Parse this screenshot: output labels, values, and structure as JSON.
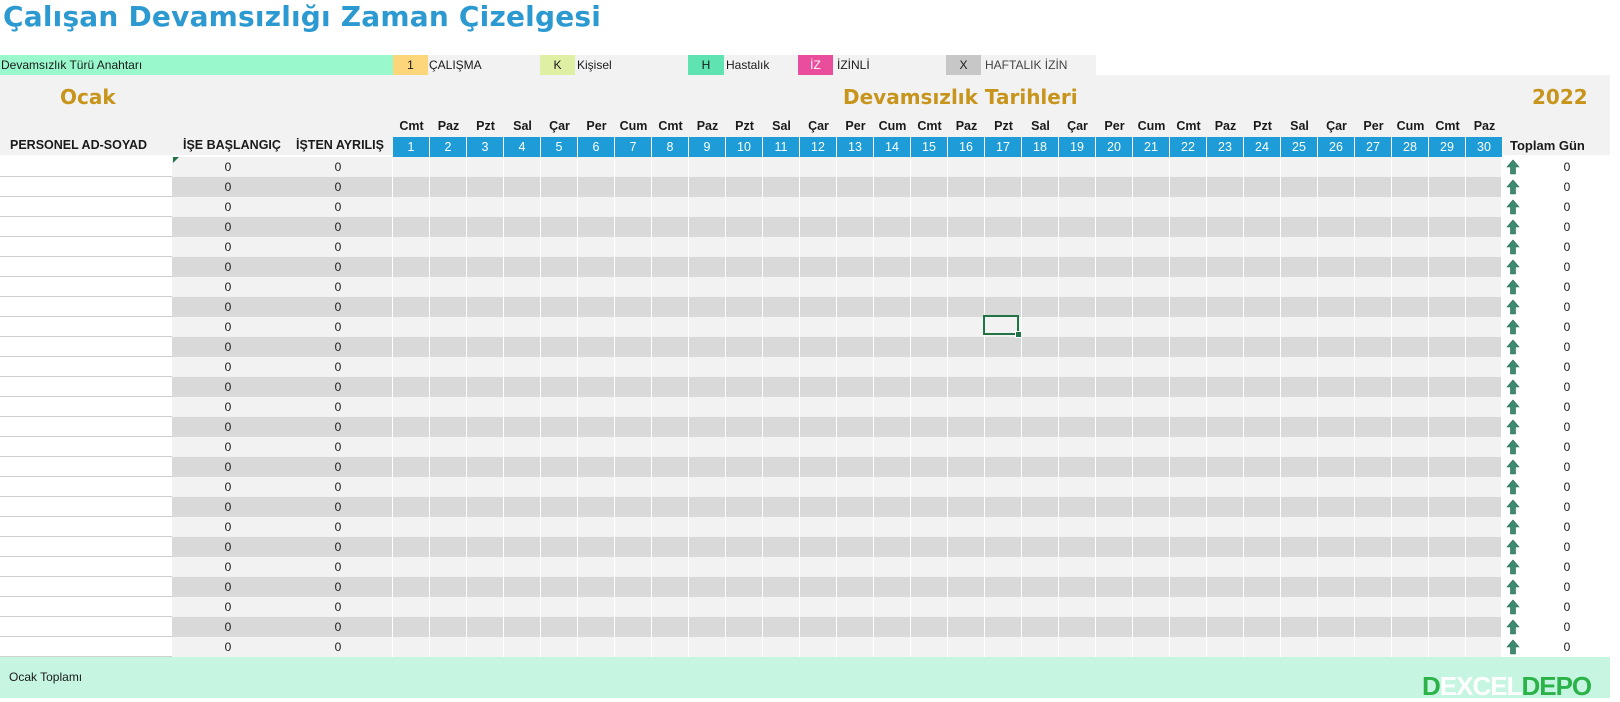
{
  "title": "Çalışan Devamsızlığı Zaman Çizelgesi",
  "legend": {
    "key_label": "Devamsızlık Türü Anahtarı",
    "items": [
      {
        "code": "1",
        "label": "ÇALIŞMA",
        "color": "#fdd57a"
      },
      {
        "code": "K",
        "label": "Kişisel",
        "color": "#dff0a4"
      },
      {
        "code": "H",
        "label": "Hastalık",
        "color": "#5fe3b0"
      },
      {
        "code": "İZ",
        "label": "İZİNLİ",
        "color": "#ea4d9b"
      },
      {
        "code": "X",
        "label": "HAFTALIK İZİN",
        "color": "#c7c7c7"
      }
    ]
  },
  "header": {
    "month": "Ocak",
    "dates_title": "Devamsızlık Tarihleri",
    "year": "2022",
    "col_name": "PERSONEL AD-SOYAD",
    "col_start": "İŞE BAŞLANGIÇ",
    "col_end": "İŞTEN AYRILIŞ",
    "col_total": "Toplam Gün"
  },
  "days": [
    {
      "name": "Cmt",
      "num": "1"
    },
    {
      "name": "Paz",
      "num": "2"
    },
    {
      "name": "Pzt",
      "num": "3"
    },
    {
      "name": "Sal",
      "num": "4"
    },
    {
      "name": "Çar",
      "num": "5"
    },
    {
      "name": "Per",
      "num": "6"
    },
    {
      "name": "Cum",
      "num": "7"
    },
    {
      "name": "Cmt",
      "num": "8"
    },
    {
      "name": "Paz",
      "num": "9"
    },
    {
      "name": "Pzt",
      "num": "10"
    },
    {
      "name": "Sal",
      "num": "11"
    },
    {
      "name": "Çar",
      "num": "12"
    },
    {
      "name": "Per",
      "num": "13"
    },
    {
      "name": "Cum",
      "num": "14"
    },
    {
      "name": "Cmt",
      "num": "15"
    },
    {
      "name": "Paz",
      "num": "16"
    },
    {
      "name": "Pzt",
      "num": "17"
    },
    {
      "name": "Sal",
      "num": "18"
    },
    {
      "name": "Çar",
      "num": "19"
    },
    {
      "name": "Per",
      "num": "20"
    },
    {
      "name": "Cum",
      "num": "21"
    },
    {
      "name": "Cmt",
      "num": "22"
    },
    {
      "name": "Paz",
      "num": "23"
    },
    {
      "name": "Pzt",
      "num": "24"
    },
    {
      "name": "Sal",
      "num": "25"
    },
    {
      "name": "Çar",
      "num": "26"
    },
    {
      "name": "Per",
      "num": "27"
    },
    {
      "name": "Cum",
      "num": "28"
    },
    {
      "name": "Cmt",
      "num": "29"
    },
    {
      "name": "Paz",
      "num": "30"
    }
  ],
  "rows": [
    {
      "start": "0",
      "end": "0",
      "total": "0"
    },
    {
      "start": "0",
      "end": "0",
      "total": "0"
    },
    {
      "start": "0",
      "end": "0",
      "total": "0"
    },
    {
      "start": "0",
      "end": "0",
      "total": "0"
    },
    {
      "start": "0",
      "end": "0",
      "total": "0"
    },
    {
      "start": "0",
      "end": "0",
      "total": "0"
    },
    {
      "start": "0",
      "end": "0",
      "total": "0"
    },
    {
      "start": "0",
      "end": "0",
      "total": "0"
    },
    {
      "start": "0",
      "end": "0",
      "total": "0"
    },
    {
      "start": "0",
      "end": "0",
      "total": "0"
    },
    {
      "start": "0",
      "end": "0",
      "total": "0"
    },
    {
      "start": "0",
      "end": "0",
      "total": "0"
    },
    {
      "start": "0",
      "end": "0",
      "total": "0"
    },
    {
      "start": "0",
      "end": "0",
      "total": "0"
    },
    {
      "start": "0",
      "end": "0",
      "total": "0"
    },
    {
      "start": "0",
      "end": "0",
      "total": "0"
    },
    {
      "start": "0",
      "end": "0",
      "total": "0"
    },
    {
      "start": "0",
      "end": "0",
      "total": "0"
    },
    {
      "start": "0",
      "end": "0",
      "total": "0"
    },
    {
      "start": "0",
      "end": "0",
      "total": "0"
    },
    {
      "start": "0",
      "end": "0",
      "total": "0"
    },
    {
      "start": "0",
      "end": "0",
      "total": "0"
    },
    {
      "start": "0",
      "end": "0",
      "total": "0"
    },
    {
      "start": "0",
      "end": "0",
      "total": "0"
    },
    {
      "start": "0",
      "end": "0",
      "total": "0"
    }
  ],
  "footer": {
    "label": "Ocak Toplamı"
  },
  "logo": {
    "text_a": "EXCEL",
    "text_b": "DEPO"
  },
  "colors": {
    "title": "#2c9ad1",
    "gold": "#c8951c",
    "day_header": "#1e9cd7",
    "arrow": "#3d8b6e"
  }
}
